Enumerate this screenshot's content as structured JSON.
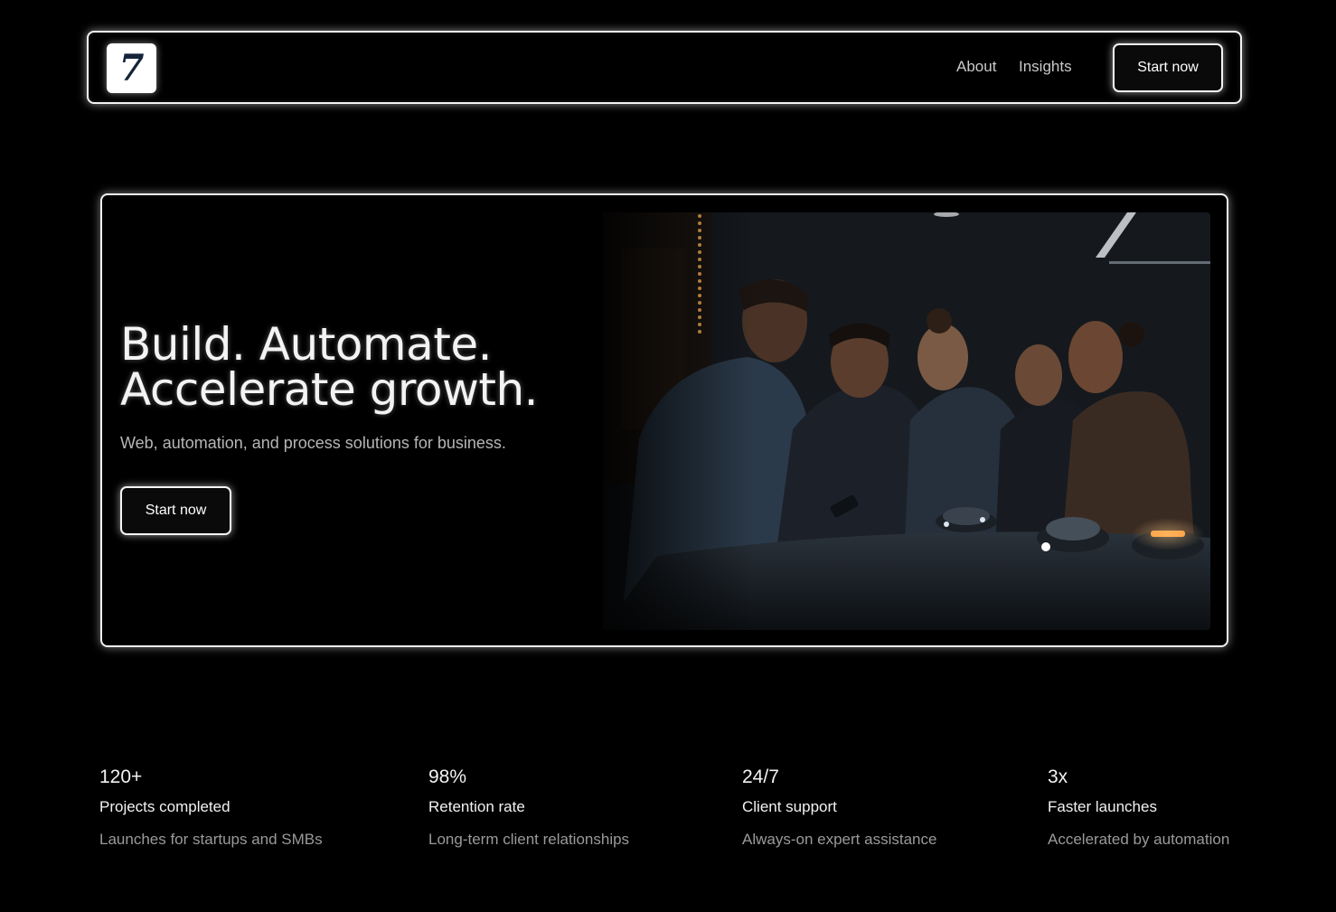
{
  "nav": {
    "logo_text": "7",
    "links": [
      {
        "label": "About"
      },
      {
        "label": "Insights"
      }
    ],
    "cta_label": "Start now"
  },
  "hero": {
    "headline_line1": "Build. Automate.",
    "headline_line2": "Accelerate growth.",
    "subtext": "Web, automation, and process solutions for business.",
    "cta_label": "Start now",
    "image_alt": "team-meeting-photo"
  },
  "stats": [
    {
      "value": "120+",
      "label": "Projects completed",
      "desc": "Launches for startups and SMBs"
    },
    {
      "value": "98%",
      "label": "Retention rate",
      "desc": "Long-term client relationships"
    },
    {
      "value": "24/7",
      "label": "Client support",
      "desc": "Always-on expert assistance"
    },
    {
      "value": "3x",
      "label": "Faster launches",
      "desc": "Accelerated by automation"
    }
  ],
  "colors": {
    "background": "#000000",
    "border_glow": "#f2f2f2",
    "text_primary": "#f3f3f3",
    "text_secondary": "#9a9a9a",
    "logo_ink": "#16243a"
  }
}
